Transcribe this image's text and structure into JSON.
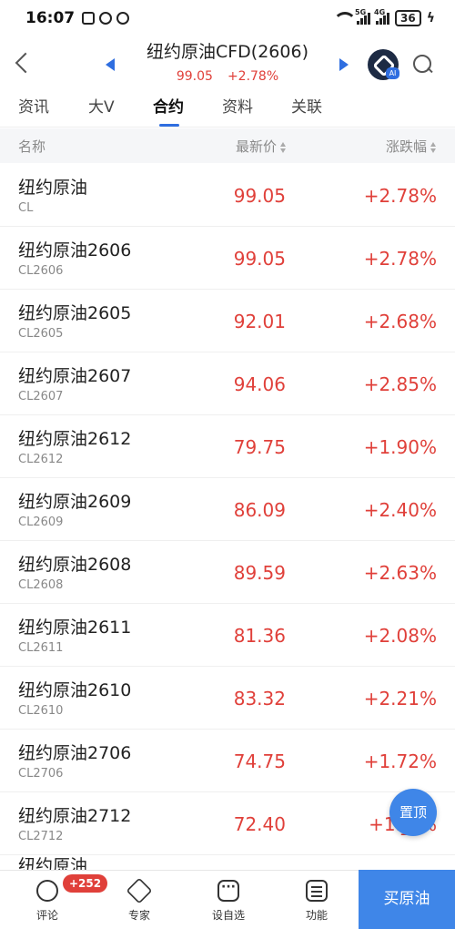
{
  "status_bar": {
    "time": "16:07",
    "network_1": "5G",
    "network_2": "4G",
    "battery": "36"
  },
  "header": {
    "title": "纽约原油CFD(2606)",
    "price": "99.05",
    "change": "+2.78%",
    "ai_tag": "AI"
  },
  "tabs": [
    {
      "label": "资讯"
    },
    {
      "label": "大V"
    },
    {
      "label": "合约",
      "selected": true
    },
    {
      "label": "资料"
    },
    {
      "label": "关联"
    }
  ],
  "columns": {
    "name": "名称",
    "price": "最新价",
    "change": "涨跌幅"
  },
  "rows": [
    {
      "name": "纽约原油",
      "code": "CL",
      "price": "99.05",
      "change": "+2.78%"
    },
    {
      "name": "纽约原油2606",
      "code": "CL2606",
      "price": "99.05",
      "change": "+2.78%"
    },
    {
      "name": "纽约原油2605",
      "code": "CL2605",
      "price": "92.01",
      "change": "+2.68%"
    },
    {
      "name": "纽约原油2607",
      "code": "CL2607",
      "price": "94.06",
      "change": "+2.85%"
    },
    {
      "name": "纽约原油2612",
      "code": "CL2612",
      "price": "79.75",
      "change": "+1.90%"
    },
    {
      "name": "纽约原油2609",
      "code": "CL2609",
      "price": "86.09",
      "change": "+2.40%"
    },
    {
      "name": "纽约原油2608",
      "code": "CL2608",
      "price": "89.59",
      "change": "+2.63%"
    },
    {
      "name": "纽约原油2611",
      "code": "CL2611",
      "price": "81.36",
      "change": "+2.08%"
    },
    {
      "name": "纽约原油2610",
      "code": "CL2610",
      "price": "83.32",
      "change": "+2.21%"
    },
    {
      "name": "纽约原油2706",
      "code": "CL2706",
      "price": "74.75",
      "change": "+1.72%"
    },
    {
      "name": "纽约原油2712",
      "code": "CL2712",
      "price": "72.40",
      "change": "+1.__%"
    }
  ],
  "partial_row_name": "纽约原油",
  "pin_button": "置顶",
  "bottom_bar": {
    "comment_label": "评论",
    "comment_badge": "+252",
    "expert_label": "专家",
    "watchlist_label": "设自选",
    "functions_label": "功能",
    "buy_label": "买原油"
  },
  "colors": {
    "accent": "#3f86e8",
    "up": "#e0403a",
    "tab_indicator": "#2f6ee0"
  }
}
